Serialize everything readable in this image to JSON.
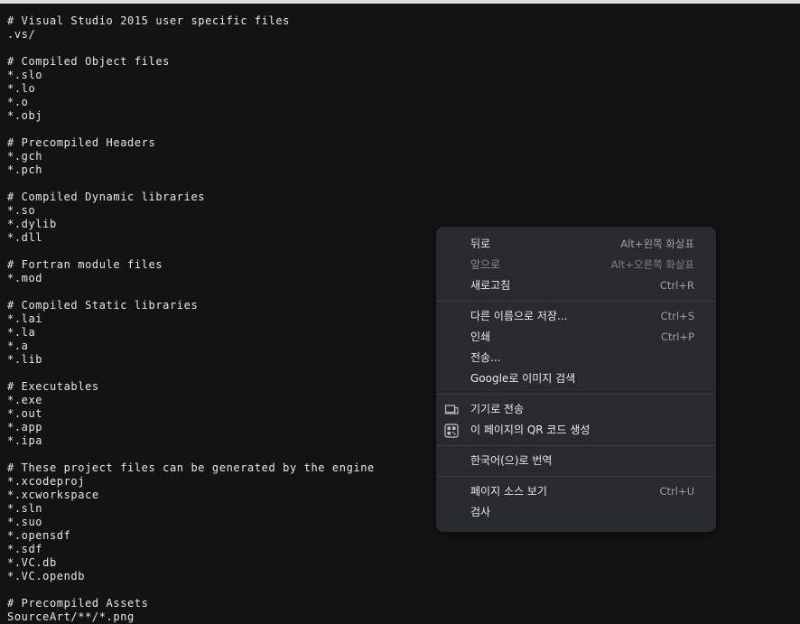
{
  "file_lines": [
    "# Visual Studio 2015 user specific files",
    ".vs/",
    "",
    "# Compiled Object files",
    "*.slo",
    "*.lo",
    "*.o",
    "*.obj",
    "",
    "# Precompiled Headers",
    "*.gch",
    "*.pch",
    "",
    "# Compiled Dynamic libraries",
    "*.so",
    "*.dylib",
    "*.dll",
    "",
    "# Fortran module files",
    "*.mod",
    "",
    "# Compiled Static libraries",
    "*.lai",
    "*.la",
    "*.a",
    "*.lib",
    "",
    "# Executables",
    "*.exe",
    "*.out",
    "*.app",
    "*.ipa",
    "",
    "# These project files can be generated by the engine",
    "*.xcodeproj",
    "*.xcworkspace",
    "*.sln",
    "*.suo",
    "*.opensdf",
    "*.sdf",
    "*.VC.db",
    "*.VC.opendb",
    "",
    "# Precompiled Assets",
    "SourceArt/**/*.png"
  ],
  "context_menu": {
    "back": {
      "label": "뒤로",
      "shortcut": "Alt+왼쪽 화살표"
    },
    "forward": {
      "label": "앞으로",
      "shortcut": "Alt+오른쪽 화살표"
    },
    "reload": {
      "label": "새로고침",
      "shortcut": "Ctrl+R"
    },
    "save_as": {
      "label": "다른 이름으로 저장...",
      "shortcut": "Ctrl+S"
    },
    "print": {
      "label": "인쇄",
      "shortcut": "Ctrl+P"
    },
    "cast": {
      "label": "전송..."
    },
    "google_image_search": {
      "label": "Google로 이미지 검색"
    },
    "send_to_devices": {
      "label": "기기로 전송",
      "icon": "devices-icon"
    },
    "qr_code": {
      "label": "이 페이지의 QR 코드 생성",
      "icon": "qr-code-icon"
    },
    "translate": {
      "label": "한국어(으)로 번역"
    },
    "view_source": {
      "label": "페이지 소스 보기",
      "shortcut": "Ctrl+U"
    },
    "inspect": {
      "label": "검사"
    }
  }
}
